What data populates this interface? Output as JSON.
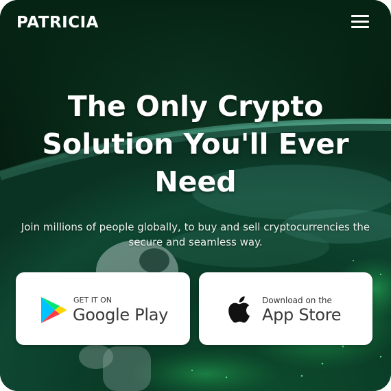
{
  "header": {
    "brand": "PATRICIA",
    "menu_icon": "hamburger-menu-icon"
  },
  "hero": {
    "headline_line1": "The Only Crypto",
    "headline_line2": "Solution You'll Ever",
    "headline_line3": "Need",
    "subtext_line1": "Join millions of people globally, to buy and sell cryptocurrencies the",
    "subtext_line2": "secure and seamless way."
  },
  "downloads": {
    "google_play": {
      "small_label": "GET IT ON",
      "big_label": "Google Play",
      "icon": "google-play-icon"
    },
    "app_store": {
      "small_label": "Download on the",
      "big_label": "App Store",
      "icon": "apple-icon"
    }
  },
  "colors": {
    "background_dark": "#072616",
    "earth_glow": "#2fd97a",
    "text": "#ffffff",
    "button_bg": "#ffffff"
  }
}
